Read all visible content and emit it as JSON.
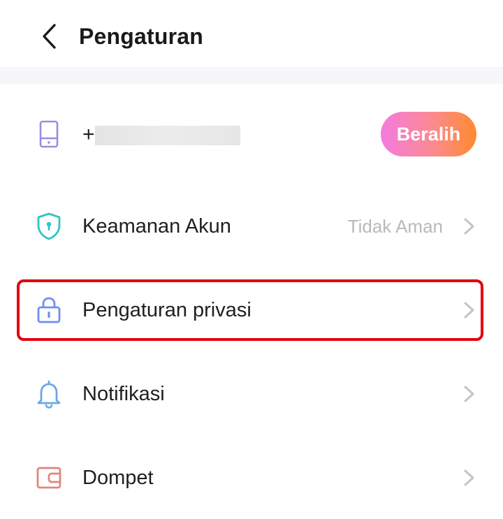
{
  "header": {
    "title": "Pengaturan",
    "back_icon": "chevron-left-icon"
  },
  "account": {
    "icon": "phone-device-icon",
    "icon_color": "#9b8be0",
    "number_prefix": "+",
    "number_masked": true,
    "switch_label": "Beralih",
    "switch_gradient": [
      "#f57be0",
      "#ff8a2e"
    ]
  },
  "settings": [
    {
      "label": "Keamanan Akun",
      "value": "Tidak Aman",
      "icon": "shield-icon",
      "icon_color": "#2fc3c9"
    },
    {
      "label": "Pengaturan privasi",
      "value": "",
      "icon": "lock-icon",
      "icon_color": "#6f8ef0",
      "highlighted": true
    },
    {
      "label": "Notifikasi",
      "value": "",
      "icon": "bell-icon",
      "icon_color": "#6aa8e8"
    },
    {
      "label": "Dompet",
      "value": "",
      "icon": "wallet-icon",
      "icon_color": "#e2857c"
    }
  ],
  "colors": {
    "chevron": "#c4c4c8",
    "secondary_text": "#b9b9bd",
    "highlight_border": "#e3000f",
    "band": "#f7f7f9"
  }
}
